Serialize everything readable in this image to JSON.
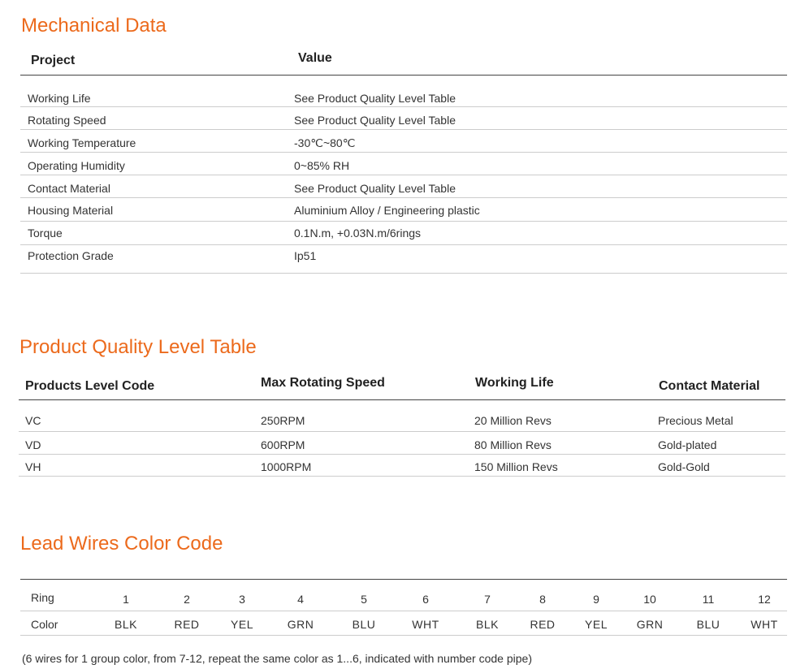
{
  "mechanical": {
    "title": "Mechanical Data",
    "headers": {
      "project": "Project",
      "value": "Value"
    },
    "rows": [
      {
        "project": "Working Life",
        "value": "See Product Quality Level Table"
      },
      {
        "project": "Rotating Speed",
        "value": "See Product Quality Level Table"
      },
      {
        "project": "Working Temperature",
        "value": "-30℃~80℃"
      },
      {
        "project": "Operating Humidity",
        "value": "0~85% RH"
      },
      {
        "project": "Contact Material",
        "value": "See Product Quality Level Table"
      },
      {
        "project": "Housing Material",
        "value": "Aluminium Alloy / Engineering plastic"
      },
      {
        "project": "Torque",
        "value": "0.1N.m,   +0.03N.m/6rings"
      },
      {
        "project": "Protection Grade",
        "value": "Ip51"
      }
    ]
  },
  "quality": {
    "title": "Product Quality Level Table",
    "headers": {
      "code": "Products Level Code",
      "speed": "Max Rotating Speed",
      "life": "Working Life",
      "material": "Contact Material"
    },
    "rows": [
      {
        "code": "VC",
        "speed": "250RPM",
        "life": "20 Million Revs",
        "material": "Precious Metal"
      },
      {
        "code": "VD",
        "speed": "600RPM",
        "life": "80 Million Revs",
        "material": "Gold-plated"
      },
      {
        "code": "VH",
        "speed": "1000RPM",
        "life": "150 Million Revs",
        "material": "Gold-Gold"
      }
    ]
  },
  "lead_wires": {
    "title": "Lead Wires Color Code",
    "ring_label": "Ring",
    "color_label": "Color",
    "rings": [
      "1",
      "2",
      "3",
      "4",
      "5",
      "6",
      "7",
      "8",
      "9",
      "10",
      "11",
      "12"
    ],
    "colors": [
      "BLK",
      "RED",
      "YEL",
      "GRN",
      "BLU",
      "WHT",
      "BLK",
      "RED",
      "YEL",
      "GRN",
      "BLU",
      "WHT"
    ],
    "note": "(6 wires for 1 group color, from 7-12, repeat the same color as 1...6, indicated with number code pipe)"
  }
}
